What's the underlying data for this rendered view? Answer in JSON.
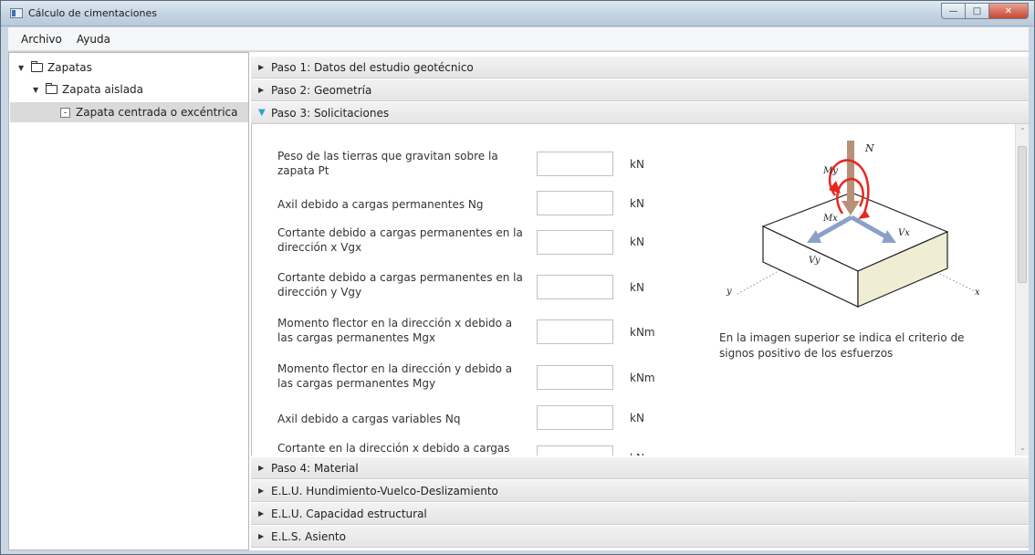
{
  "window": {
    "title": "Cálculo de cimentaciones"
  },
  "menu": {
    "items": [
      "Archivo",
      "Ayuda"
    ]
  },
  "tree": {
    "root": "Zapatas",
    "child": "Zapata aislada",
    "leaf": "Zapata centrada o excéntrica"
  },
  "steps": {
    "step1": "Paso 1: Datos del estudio geotécnico",
    "step2": "Paso 2: Geometría",
    "step3": "Paso 3: Solicitaciones",
    "step4": "Paso 4: Material",
    "elu1": "E.L.U. Hundimiento-Vuelco-Deslizamiento",
    "elu2": "E.L.U. Capacidad estructural",
    "els": "E.L.S. Asiento"
  },
  "fields": [
    {
      "label": "Peso de las tierras que gravitan sobre la zapata Pt",
      "value": "",
      "unit": "kN"
    },
    {
      "label": "Axil debido a cargas permanentes Ng",
      "value": "",
      "unit": "kN"
    },
    {
      "label": "Cortante debido a cargas permanentes en la dirección x Vgx",
      "value": "",
      "unit": "kN"
    },
    {
      "label": "Cortante debido a cargas permanentes en la dirección y Vgy",
      "value": "",
      "unit": "kN"
    },
    {
      "label": "Momento flector en la dirección x debido a las cargas permanentes Mgx",
      "value": "",
      "unit": "kNm"
    },
    {
      "label": "Momento flector en la dirección y debido a las cargas permanentes Mgy",
      "value": "",
      "unit": "kNm"
    },
    {
      "label": "Axil debido a cargas variables Nq",
      "value": "",
      "unit": "kN"
    },
    {
      "label": "Cortante en la dirección x debido a cargas",
      "value": "",
      "unit": "kN"
    }
  ],
  "diagram_labels": {
    "n": "N",
    "my": "My",
    "mx": "Mx",
    "vx": "Vx",
    "vy": "Vy",
    "y": "y",
    "x": "x"
  },
  "note": "En la imagen superior se indica el criterio de signos positivo de los esfuerzos",
  "colors": {
    "accent": "#2aa0d8",
    "moment": "#e8261e",
    "shear": "#8aa0c8",
    "axial": "#b89078"
  }
}
